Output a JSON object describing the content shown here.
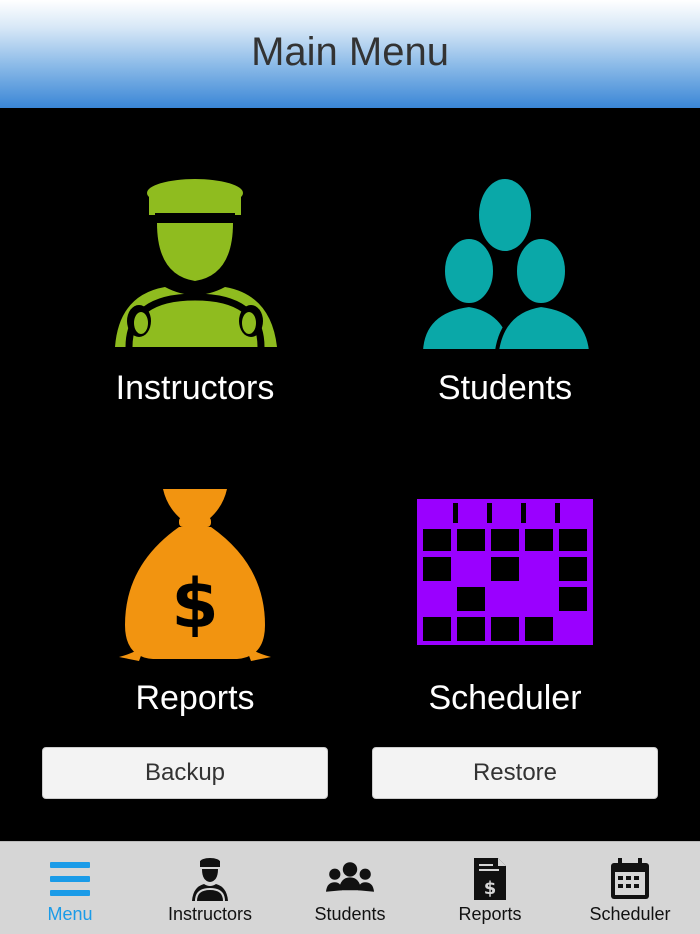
{
  "header": {
    "title": "Main Menu"
  },
  "tiles": [
    {
      "label": "Instructors",
      "icon": "driver-icon",
      "color": "#8fbc1f"
    },
    {
      "label": "Students",
      "icon": "students-group-icon",
      "color": "#0aa8a8"
    },
    {
      "label": "Reports",
      "icon": "money-bag-icon",
      "color": "#f29410"
    },
    {
      "label": "Scheduler",
      "icon": "calendar-grid-icon",
      "color": "#9a00ff"
    }
  ],
  "buttons": {
    "backup": "Backup",
    "restore": "Restore"
  },
  "tabbar": {
    "active_color": "#1a9be8",
    "items": [
      {
        "label": "Menu",
        "icon": "hamburger-menu-icon"
      },
      {
        "label": "Instructors",
        "icon": "driver-icon"
      },
      {
        "label": "Students",
        "icon": "students-group-icon"
      },
      {
        "label": "Reports",
        "icon": "report-document-icon"
      },
      {
        "label": "Scheduler",
        "icon": "calendar-icon"
      }
    ]
  }
}
